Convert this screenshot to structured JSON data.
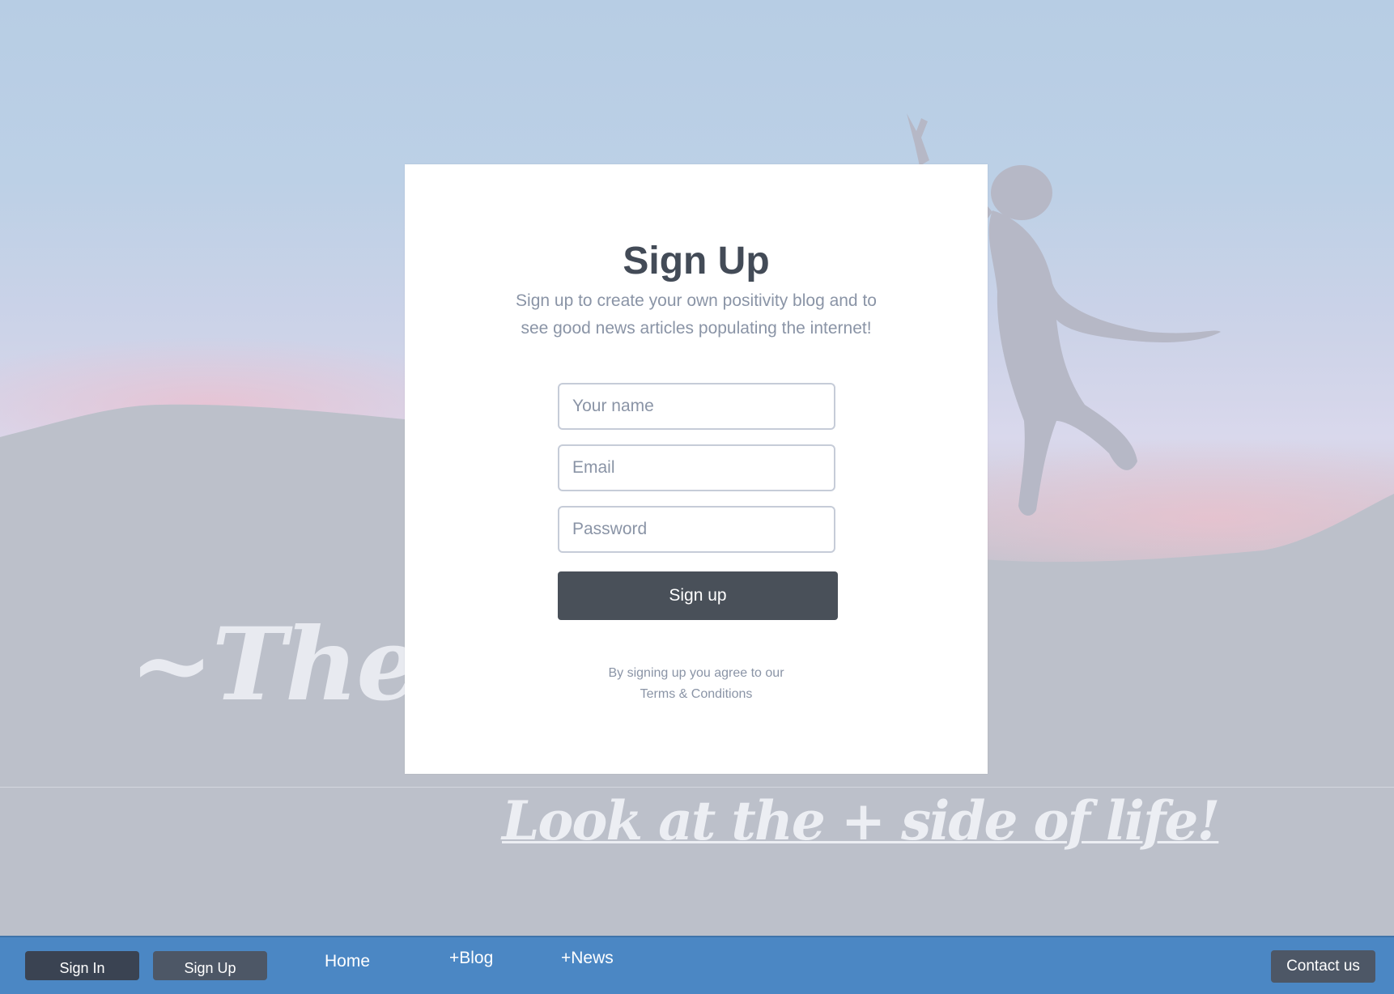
{
  "background": {
    "hero_title": "~The +S",
    "tagline": "Look at the + side of life!"
  },
  "modal": {
    "title": "Sign Up",
    "subtitle": "Sign up to create your own positivity blog and to see good news articles populating the internet!",
    "fields": {
      "name_placeholder": "Your name",
      "email_placeholder": "Email",
      "password_placeholder": "Password"
    },
    "submit_label": "Sign up",
    "terms_text": "By signing up you agree to our",
    "terms_link": "Terms & Conditions"
  },
  "navbar": {
    "signin_label": "Sign In",
    "signup_label": "Sign Up",
    "links": [
      "Home",
      "+Blog",
      "+News"
    ],
    "contact_label": "Contact us",
    "color": "#4b87c4"
  }
}
